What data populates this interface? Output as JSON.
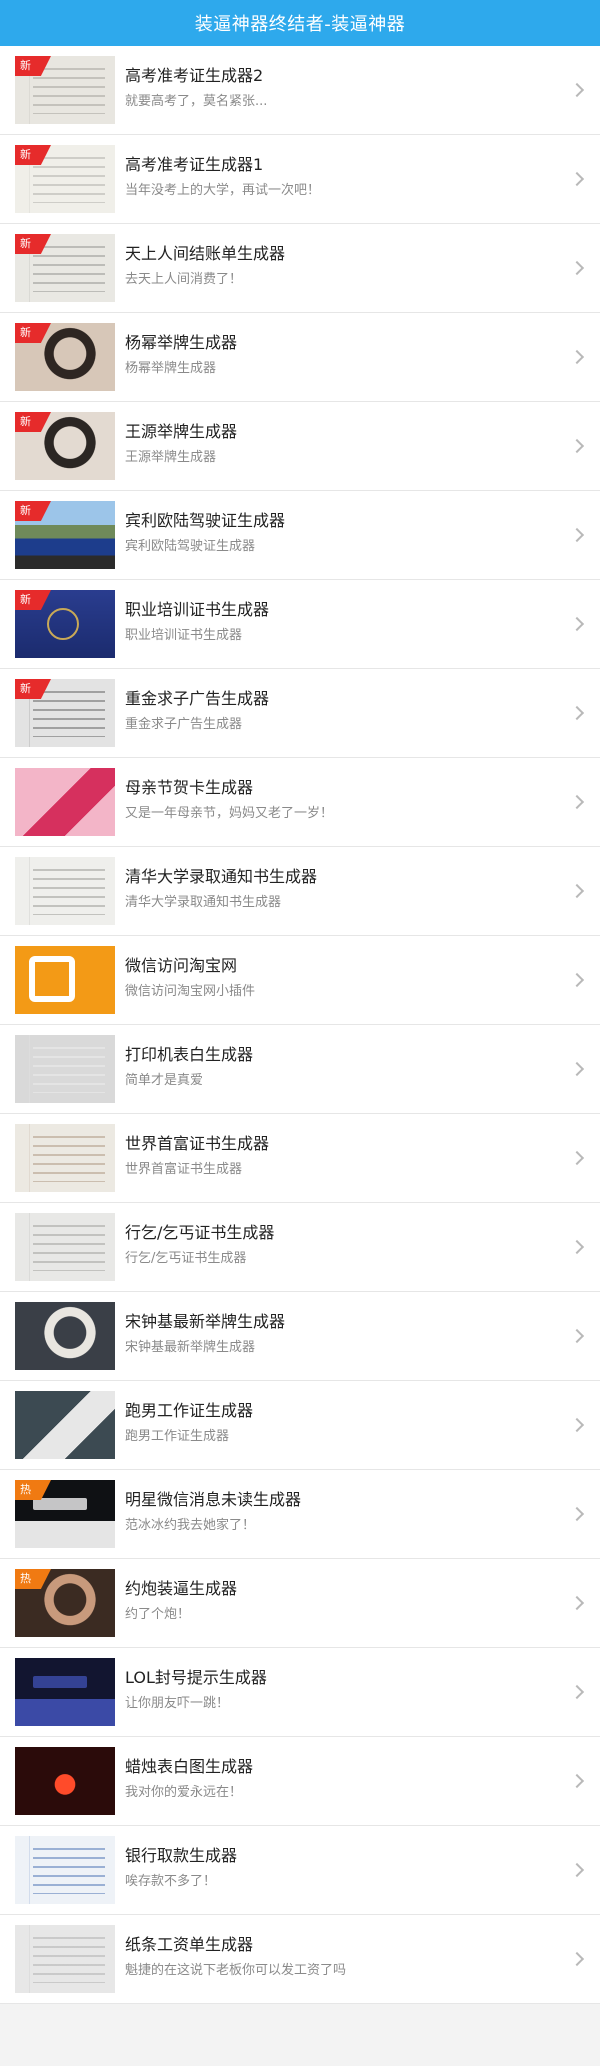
{
  "header": {
    "title": "装逼神器终结者-装逼神器"
  },
  "colors": {
    "header_bg": "#2ea9ec",
    "badge_new": "#e62b2b",
    "badge_hot": "#f07a12"
  },
  "items": [
    {
      "title": "高考准考证生成器2",
      "subtitle": "就要高考了，莫名紧张...",
      "badge": "新",
      "badge_type": "new",
      "thumb": [
        "#e8e6e0",
        "#8e8c86",
        "paper"
      ]
    },
    {
      "title": "高考准考证生成器1",
      "subtitle": "当年没考上的大学，再试一次吧！",
      "badge": "新",
      "badge_type": "new",
      "thumb": [
        "#f0efe9",
        "#9b9a95",
        "paper"
      ]
    },
    {
      "title": "天上人间结账单生成器",
      "subtitle": "去天上人间消费了！",
      "badge": "新",
      "badge_type": "new",
      "thumb": [
        "#e9e8e3",
        "#7a7a77",
        "paper"
      ]
    },
    {
      "title": "杨幂举牌生成器",
      "subtitle": "杨幂举牌生成器",
      "badge": "新",
      "badge_type": "new",
      "thumb": [
        "#d7c7b8",
        "#2e2622",
        "face"
      ]
    },
    {
      "title": "王源举牌生成器",
      "subtitle": "王源举牌生成器",
      "badge": "新",
      "badge_type": "new",
      "thumb": [
        "#e3dad1",
        "#2b2623",
        "face"
      ]
    },
    {
      "title": "宾利欧陆驾驶证生成器",
      "subtitle": "宾利欧陆驾驶证生成器",
      "badge": "新",
      "badge_type": "new",
      "thumb": [
        "#6f8a5a",
        "#1d3d8c",
        "car"
      ]
    },
    {
      "title": "职业培训证书生成器",
      "subtitle": "职业培训证书生成器",
      "badge": "新",
      "badge_type": "new",
      "thumb": [
        "#2a3d8f",
        "#c9a957",
        "cert"
      ]
    },
    {
      "title": "重金求子广告生成器",
      "subtitle": "重金求子广告生成器",
      "badge": "新",
      "badge_type": "new",
      "thumb": [
        "#e3e3e3",
        "#3a3a3a",
        "paper"
      ]
    },
    {
      "title": "母亲节贺卡生成器",
      "subtitle": "又是一年母亲节，妈妈又老了一岁！",
      "badge": "",
      "badge_type": "",
      "thumb": [
        "#f3b5c8",
        "#d6305e",
        "card"
      ]
    },
    {
      "title": "清华大学录取通知书生成器",
      "subtitle": "清华大学录取通知书生成器",
      "badge": "",
      "badge_type": "",
      "thumb": [
        "#efefec",
        "#7e7e7a",
        "paper"
      ]
    },
    {
      "title": "微信访问淘宝网",
      "subtitle": "微信访问淘宝网小插件",
      "badge": "",
      "badge_type": "",
      "thumb": [
        "#f39a16",
        "#ffffff",
        "taobao"
      ]
    },
    {
      "title": "打印机表白生成器",
      "subtitle": "简单才是真爱",
      "badge": "",
      "badge_type": "",
      "thumb": [
        "#d9d9d9",
        "#f5f5f5",
        "paper"
      ]
    },
    {
      "title": "世界首富证书生成器",
      "subtitle": "世界首富证书生成器",
      "badge": "",
      "badge_type": "",
      "thumb": [
        "#ece9e2",
        "#9a7c63",
        "paper"
      ]
    },
    {
      "title": "行乞/乞丐证书生成器",
      "subtitle": "行乞/乞丐证书生成器",
      "badge": "",
      "badge_type": "",
      "thumb": [
        "#e8e8e6",
        "#888884",
        "paper"
      ]
    },
    {
      "title": "宋钟基最新举牌生成器",
      "subtitle": "宋钟基最新举牌生成器",
      "badge": "",
      "badge_type": "",
      "thumb": [
        "#3a3f47",
        "#e9e6e0",
        "face"
      ]
    },
    {
      "title": "跑男工作证生成器",
      "subtitle": "跑男工作证生成器",
      "badge": "",
      "badge_type": "",
      "thumb": [
        "#3c4a52",
        "#e7e7e7",
        "card"
      ]
    },
    {
      "title": "明星微信消息未读生成器",
      "subtitle": "范冰冰约我去她家了！",
      "badge": "热",
      "badge_type": "hot",
      "thumb": [
        "#0f1114",
        "#e5e5e5",
        "phone"
      ]
    },
    {
      "title": "约炮装逼生成器",
      "subtitle": "约了个炮！",
      "badge": "热",
      "badge_type": "hot",
      "thumb": [
        "#3b2b22",
        "#c89a7c",
        "face"
      ]
    },
    {
      "title": "LOL封号提示生成器",
      "subtitle": "让你朋友吓一跳！",
      "badge": "",
      "badge_type": "",
      "thumb": [
        "#121530",
        "#3b4aa6",
        "phone"
      ]
    },
    {
      "title": "蜡烛表白图生成器",
      "subtitle": "我对你的爱永远在！",
      "badge": "",
      "badge_type": "",
      "thumb": [
        "#2b0b0a",
        "#ff4b2a",
        "candles"
      ]
    },
    {
      "title": "银行取款生成器",
      "subtitle": "唉存款不多了！",
      "badge": "",
      "badge_type": "",
      "thumb": [
        "#eef2f7",
        "#1c4ea0",
        "paper"
      ]
    },
    {
      "title": "纸条工资单生成器",
      "subtitle": "魁捷的在这说下老板你可以发工资了吗",
      "badge": "",
      "badge_type": "",
      "thumb": [
        "#e7e7e7",
        "#9d9d9d",
        "paper"
      ]
    }
  ]
}
